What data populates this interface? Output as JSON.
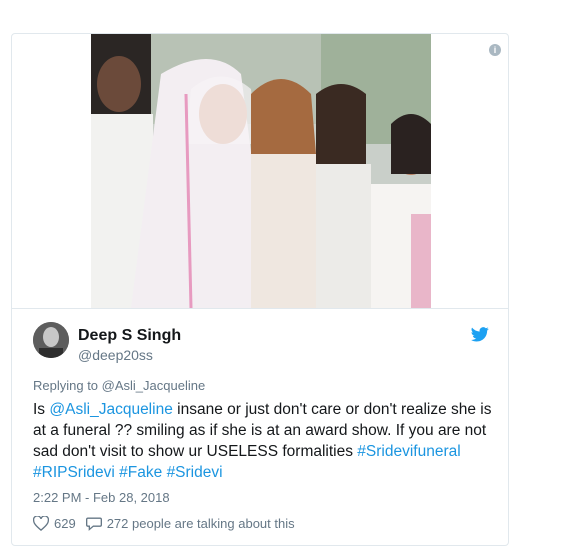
{
  "tweet": {
    "author": {
      "display_name": "Deep S Singh",
      "handle": "@deep20ss",
      "avatar_icon": "user-avatar"
    },
    "reply_to": "Replying to @Asli_Jacqueline",
    "text": {
      "p1": "Is ",
      "mention": "@Asli_Jacqueline",
      "p2": " insane or just don't care or don't realize she is at a funeral ?? smiling as if she is at an award show. If you are not sad don't visit to show ur USELESS formalities ",
      "hashtag1": "#Sridevifuneral",
      "hashtag2": "#RIPSridevi",
      "hashtag3": "#Fake",
      "hashtag4": "#Sridevi"
    },
    "timestamp": "2:22 PM - Feb 28, 2018",
    "likes": "629",
    "talking": "272 people are talking about this",
    "icons": {
      "info": "info-icon",
      "brand": "twitter-bird-icon",
      "like": "heart-icon",
      "reply": "speech-bubble-icon"
    },
    "colors": {
      "link": "#1b95e0",
      "muted": "#657786",
      "text": "#14171a",
      "border": "#e1e8ed"
    }
  }
}
